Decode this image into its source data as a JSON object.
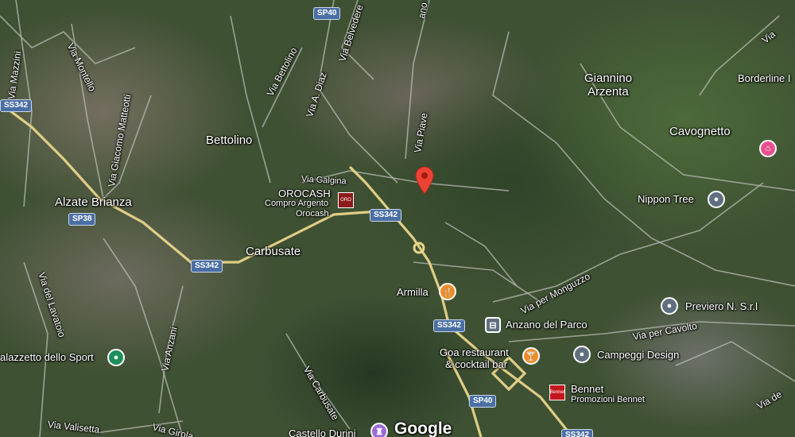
{
  "map": {
    "places": {
      "alzate": "Alzate Brianza",
      "bettolino": "Bettolino",
      "carbusate": "Carbusate",
      "giannino_1": "Giannino",
      "giannino_2": "Arzenta",
      "cavognetto": "Cavognetto",
      "orocash": "OROCASH"
    },
    "roads": {
      "via_mazzini": "Via Mazzini",
      "via_montello": "Via Montello",
      "via_matteotti": "Via Giacomo Matteotti",
      "via_bettolino": "Via Bettolino",
      "via_diaz": "Via A. Diaz",
      "via_belvedere": "Via Belvedere",
      "via_piave": "Via Piave",
      "via_galgina": "Via Galgina",
      "via_lavatoio": "Via del Lavatoio",
      "via_anzani": "Via Anzani",
      "via_carbusate": "Via Carbusate",
      "via_valisetta": "Via Valisetta",
      "via_girola": "Via Girola",
      "via_monguzzo": "Via per Monguzzo",
      "via_cavolto": "Via per Cavolto",
      "via_no": "Via",
      "via_de": "Via de",
      "via_ano": "ano"
    },
    "shields": {
      "ss342_a": "SS342",
      "sp40_a": "SP40",
      "sp38": "SP38",
      "ss342_b": "SS342",
      "ss342_c": "SS342",
      "ss342_d": "SS342",
      "sp40_b": "SP40",
      "ss342_e": "SS342"
    },
    "pois": {
      "orocash_sub": "Compro Argento",
      "orocash_sub2": "Orocash",
      "armilla": "Armilla",
      "anzano": "Anzano del Parco",
      "goa_1": "Goa restaurant",
      "goa_2": "& cocktail bar",
      "campeggi": "Campeggi Design",
      "previero": "Previero N. S.r.l",
      "nippon": "Nippon Tree",
      "borderline": "Borderline I",
      "bennet": "Bennet",
      "bennet_sub": "Promozioni Bennet",
      "palazzetto": "alazzetto dello Sport",
      "castello": "Castello Durini",
      "bennet_logo": "Bennet"
    },
    "google_logo": "Google",
    "colors": {
      "major_road": "#e8d48a",
      "minor_road": "#b9bdb5",
      "selected_pin": "#ea4335",
      "generic_poi": "#5f6f7f",
      "food_poi": "#f08c26",
      "park_poi": "#1e8f5a",
      "lodging_poi": "#e8508f",
      "culture_poi": "#9b6bd6",
      "shop_poi": "#b31b1b",
      "transit_poi": "#5f6f7f"
    }
  }
}
